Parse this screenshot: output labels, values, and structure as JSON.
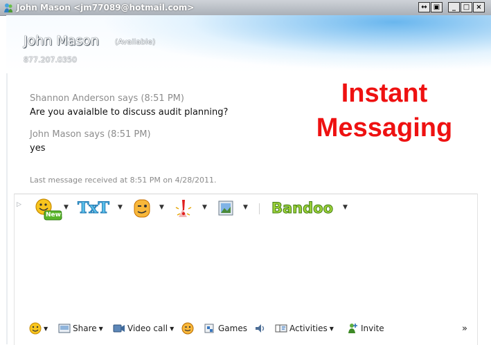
{
  "window": {
    "title": "John Mason <jm77089@hotmail.com>",
    "buttons": [
      "↔",
      "▣",
      "_",
      "□",
      "×"
    ]
  },
  "contact": {
    "name": "John Mason",
    "status": "(Available)",
    "phone": "877.207.0350"
  },
  "conversation": [
    {
      "sender": "Shannon Anderson says (8:51 PM)",
      "text": "Are you avaialble to discuss audit planning?"
    },
    {
      "sender": "John Mason says (8:51 PM)",
      "text": "yes"
    }
  ],
  "last_received": "Last message received at 8:51 PM on 4/28/2011.",
  "overlay": {
    "line1": "Instant",
    "line2": "Messaging",
    "color": "#ee1111"
  },
  "emoticon_bar": {
    "new_badge": "New!",
    "txt_label": "TxT",
    "brand": "Bandoo"
  },
  "bottom_toolbar": {
    "share": "Share",
    "video_call": "Video call",
    "games": "Games",
    "activities": "Activities",
    "invite": "Invite",
    "more": "»"
  }
}
